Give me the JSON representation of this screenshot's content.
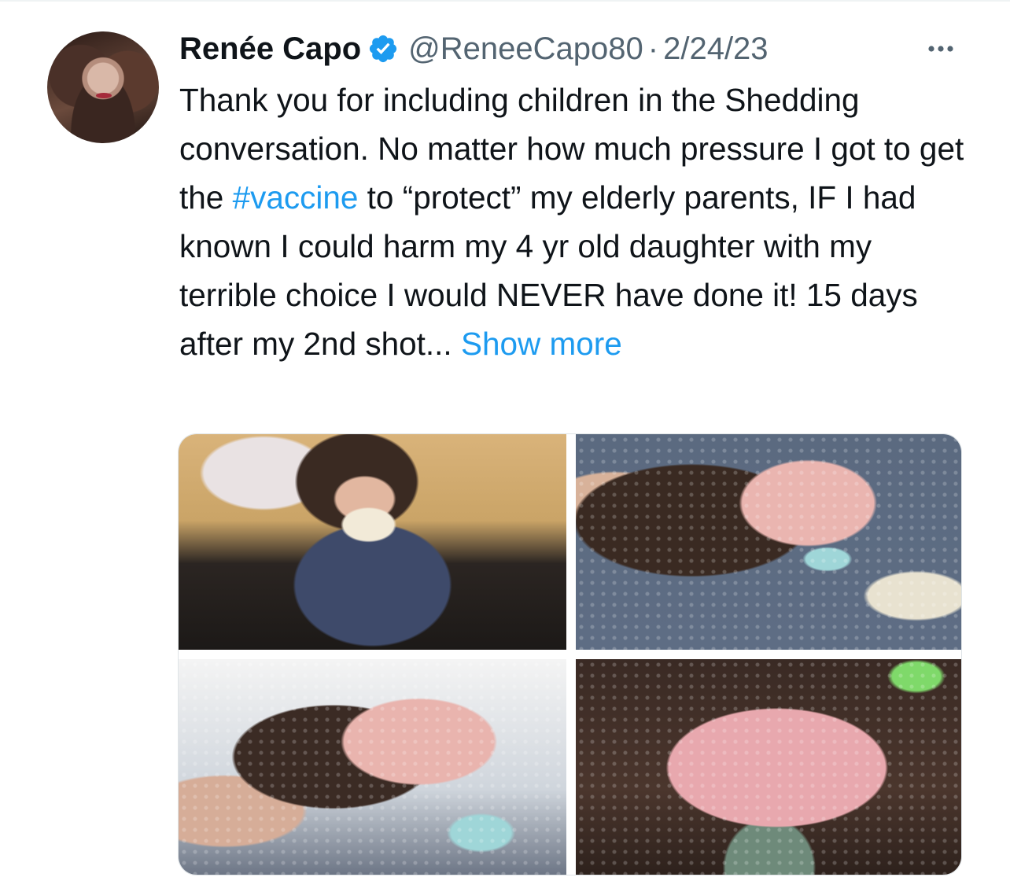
{
  "tweet": {
    "author": {
      "display_name": "Renée Capo",
      "verified_icon": "verified-badge-icon",
      "handle": "@ReneeCapo80",
      "separator": "·",
      "date": "2/24/23"
    },
    "more_icon": "more-options-icon",
    "text": {
      "before_hashtag": "Thank you for including children in the Shedding conversation. No matter how much pressure I got to get the ",
      "hashtag": "#vaccine",
      "after_hashtag": " to “protect” my elderly parents, IF I had known I could harm my 4 yr old daughter with my terrible choice I would NEVER have done it! 15 days after my 2nd shot...",
      "show_more": "Show more"
    },
    "media": {
      "photo_count": 4
    }
  },
  "colors": {
    "link": "#1d9bf0",
    "text_primary": "#0f1419",
    "text_secondary": "#536471",
    "verified": "#1d9bf0"
  }
}
